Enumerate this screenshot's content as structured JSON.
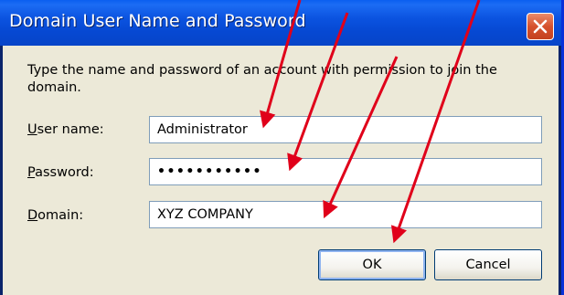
{
  "window": {
    "title": "Domain User Name and Password",
    "close_icon": "close-x-icon"
  },
  "description": "Type the name and password of an account with permission to join the domain.",
  "fields": {
    "username": {
      "label_access": "U",
      "label_rest": "ser name:",
      "value": "Administrator"
    },
    "password": {
      "label_access": "P",
      "label_rest": "assword:",
      "value": "•••••••••••"
    },
    "domain": {
      "label_access": "D",
      "label_rest": "omain:",
      "value": "XYZ COMPANY"
    }
  },
  "buttons": {
    "ok": "OK",
    "cancel": "Cancel"
  },
  "colors": {
    "titlebar": "#0b53e0",
    "client": "#ece9d8",
    "annotation_arrow": "#e0001a",
    "close_button": "#d6522e"
  },
  "annotations": {
    "arrow_icon": "red-arrow-icon",
    "arrow_count": 4
  }
}
